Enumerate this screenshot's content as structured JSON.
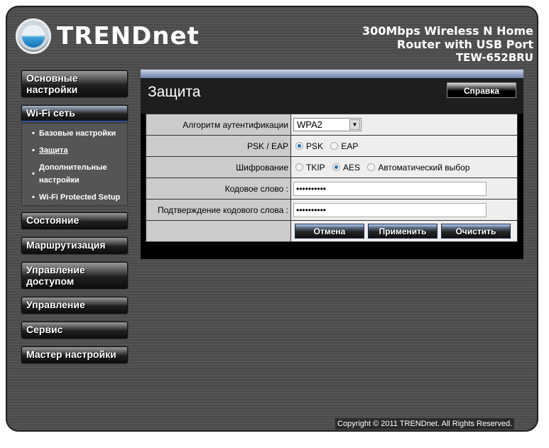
{
  "header": {
    "brand": "TRENDnet",
    "product_line1": "300Mbps Wireless N Home",
    "product_line2": "Router with USB Port",
    "model": "TEW-652BRU"
  },
  "sidebar": {
    "items": [
      {
        "label": "Основные настройки"
      },
      {
        "label": "Wi-Fi сеть",
        "active": true
      },
      {
        "label": "Состояние"
      },
      {
        "label": "Маршрутизация"
      },
      {
        "label": "Управление доступом"
      },
      {
        "label": "Управление"
      },
      {
        "label": "Сервис"
      },
      {
        "label": "Мастер настройки"
      }
    ],
    "subitems": [
      {
        "label": "Базовые настройки"
      },
      {
        "label": "Защита",
        "current": true
      },
      {
        "label": "Дополнительные настройки"
      },
      {
        "label": "Wi-Fi Protected Setup"
      }
    ]
  },
  "main": {
    "title": "Защита",
    "help_label": "Справка",
    "form": {
      "auth_label": "Алгоритм аутентификации",
      "auth_value": "WPA2",
      "pskeap_label": "PSK / EAP",
      "pskeap_options": [
        {
          "label": "PSK",
          "selected": true
        },
        {
          "label": "EAP",
          "selected": false
        }
      ],
      "cipher_label": "Шифрование",
      "cipher_options": [
        {
          "label": "TKIP",
          "selected": false
        },
        {
          "label": "AES",
          "selected": true
        },
        {
          "label": "Автоматический выбор",
          "selected": false
        }
      ],
      "passphrase_label": "Кодовое слово :",
      "passphrase_value": "••••••••••",
      "confirm_label": "Подтверждение кодового слова :",
      "confirm_value": "••••••••••"
    },
    "buttons": {
      "cancel": "Отмена",
      "apply": "Применить",
      "clear": "Очистить"
    }
  },
  "footer": {
    "copyright": "Copyright © 2011 TRENDnet. All Rights Reserved."
  }
}
